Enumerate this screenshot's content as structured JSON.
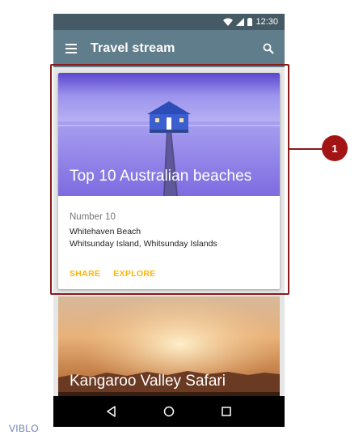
{
  "statusbar": {
    "time": "12:30"
  },
  "appbar": {
    "title": "Travel stream"
  },
  "cards": [
    {
      "title": "Top 10 Australian beaches",
      "subhead": "Number 10",
      "line1": "Whitehaven Beach",
      "line2": "Whitsunday Island, Whitsunday Islands",
      "actions": [
        "SHARE",
        "EXPLORE"
      ]
    },
    {
      "title": "Kangaroo Valley Safari"
    }
  ],
  "annotation": {
    "badge": "1"
  },
  "watermark": "VIBLO",
  "colors": {
    "statusbar": "#455a64",
    "appbar": "#607d8b",
    "action_accent": "#ffb300",
    "annotation": "#a31515"
  },
  "icons": [
    "wifi-icon",
    "signal-icon",
    "battery-icon",
    "menu-icon",
    "search-icon",
    "back-icon",
    "home-icon",
    "recents-icon"
  ]
}
